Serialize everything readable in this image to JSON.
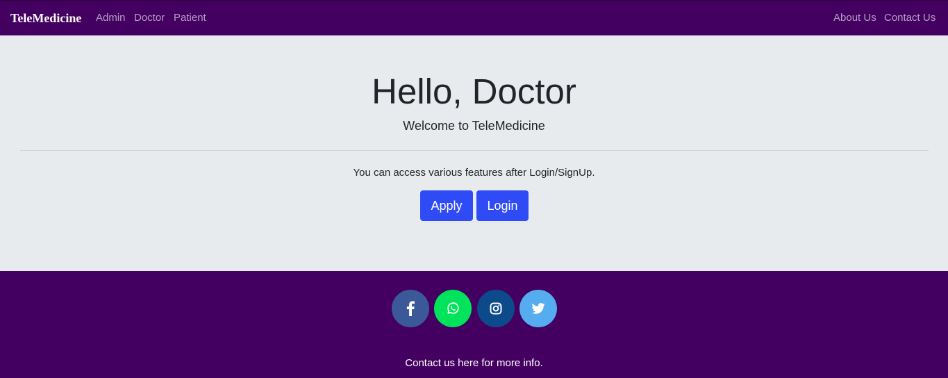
{
  "navbar": {
    "brand": "TeleMedicine",
    "left_links": [
      "Admin",
      "Doctor",
      "Patient"
    ],
    "right_links": [
      "About Us",
      "Contact Us"
    ]
  },
  "hero": {
    "title": "Hello, Doctor",
    "subtitle": "Welcome to TeleMedicine",
    "text": "You can access various features after Login/SignUp.",
    "apply_label": "Apply",
    "login_label": "Login"
  },
  "footer": {
    "social": [
      {
        "icon": "facebook-icon",
        "color": "#3b5998"
      },
      {
        "icon": "whatsapp-icon",
        "color": "#00e35a"
      },
      {
        "icon": "instagram-icon",
        "color": "#0d4a8c"
      },
      {
        "icon": "twitter-icon",
        "color": "#55acee"
      }
    ],
    "contact_text": "Contact us here for more info."
  },
  "colors": {
    "navbar_bg": "#440061",
    "jumbotron_bg": "#e8ebee",
    "button_bg": "#2f4bf5"
  }
}
